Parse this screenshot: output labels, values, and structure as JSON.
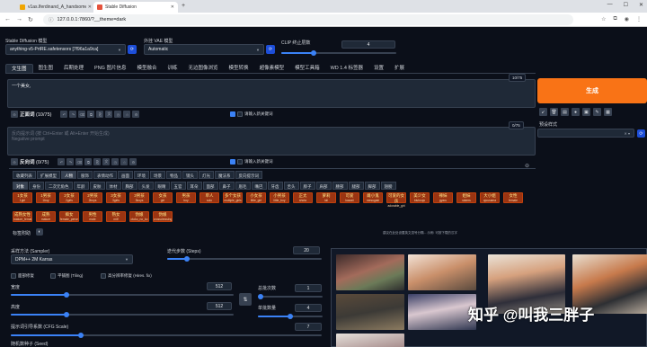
{
  "browser": {
    "tabs": [
      {
        "title": "v1as.lferdinand_A_handsome",
        "active": false
      },
      {
        "title": "Stable Diffusion",
        "active": true
      }
    ],
    "url": "127.0.0.1:7860/?__theme=dark"
  },
  "model": {
    "checkpoint_label": "Stable Diffusion 模型",
    "checkpoint_value": "anything-v5-PrtRE.safetensors [7f96a1a9ca]",
    "vae_label": "外挂 VAE 模型",
    "vae_value": "Automatic",
    "clip_label": "CLIP 终止层数",
    "clip_value": "4"
  },
  "tabs": [
    "文生图",
    "图生图",
    "后期处理",
    "PNG 图片信息",
    "模型融合",
    "训练",
    "无边图像浏览",
    "模型转换",
    "超像素模型",
    "模型工具箱",
    "WD 1.4 标签器",
    "设置",
    "扩展"
  ],
  "prompt": {
    "text": "一个美女,",
    "counter": "10/75",
    "section_label": "正面词",
    "section_count": "(10/75)",
    "checkbox_label": "请输入新关键词"
  },
  "negative": {
    "placeholder_line1": "反向提示词 (按 Ctrl+Enter 或 Alt+Enter 开始生成)",
    "placeholder_line2": "Negative prompt",
    "counter": "0/75",
    "section_label": "反向词",
    "section_count": "(0/75)",
    "checkbox_label": "请输入新关键词"
  },
  "generate": {
    "label": "生成",
    "style_label": "预设样式"
  },
  "category_tabs": [
    "收藏列表",
    "扩展模型",
    "人物",
    "服饰",
    "表情动作",
    "画面",
    "环境",
    "场景",
    "物品",
    "镜头",
    "灯光",
    "魔法系",
    "反向提示词"
  ],
  "sub_tabs": [
    "对象",
    "身份",
    "二次元角色",
    "年龄",
    "皮肤",
    "体材",
    "胸部",
    "头发",
    "眼睛",
    "五官",
    "耳朵",
    "面部",
    "鼻子",
    "眉毛",
    "嘴巴",
    "牙齿",
    "舌头",
    "脖子",
    "肩部",
    "腰部",
    "腿部",
    "脚部",
    "翅膀"
  ],
  "keywords_row1": [
    {
      "zh": "1女孩",
      "en": "1girl"
    },
    {
      "zh": "1男孩",
      "en": "1boy"
    },
    {
      "zh": "2女孩",
      "en": "2girls"
    },
    {
      "zh": "2男孩",
      "en": "2boys"
    },
    {
      "zh": "3女孩",
      "en": "3girls"
    },
    {
      "zh": "3男孩",
      "en": "3boys"
    },
    {
      "zh": "女孩",
      "en": "girl"
    },
    {
      "zh": "男孩",
      "en": "boy"
    },
    {
      "zh": "单人",
      "en": "solo"
    },
    {
      "zh": "多个女孩",
      "en": "multiple_girls"
    },
    {
      "zh": "小女孩",
      "en": "little_girl"
    },
    {
      "zh": "小男孩",
      "en": "little_boy"
    },
    {
      "zh": "正太",
      "en": "shota"
    },
    {
      "zh": "萝莉",
      "en": "loli"
    },
    {
      "zh": "可爱",
      "en": "kawaii"
    },
    {
      "zh": "雌小鬼",
      "en": "mesugaki"
    },
    {
      "zh": "可爱的女孩",
      "en": "adorable_girl"
    },
    {
      "zh": "美少女",
      "en": "bishoujo"
    },
    {
      "zh": "辣妹",
      "en": "gyaru"
    },
    {
      "zh": "姐妹",
      "en": "sisters"
    },
    {
      "zh": "大小姐",
      "en": "ojousama"
    },
    {
      "zh": "女性",
      "en": "female"
    }
  ],
  "keywords_row2": [
    {
      "zh": "成熟女性",
      "en": "mature_female"
    },
    {
      "zh": "成熟",
      "en": "mature"
    },
    {
      "zh": "痴女",
      "en": "female_pervert"
    },
    {
      "zh": "男性",
      "en": "male"
    },
    {
      "zh": "熟女",
      "en": "milf"
    },
    {
      "zh": "伪娘",
      "en": "otoko_no_ko"
    },
    {
      "zh": "伪娘",
      "en": "crossdressing"
    }
  ],
  "tag_helper": {
    "label": "标签附助",
    "note": "建议在此处设置英文逗号分隔... 示例: 可按下载的汉字"
  },
  "settings": {
    "sampler_label": "采样方法 (Sampler)",
    "sampler_value": "DPM++ 2M Karras",
    "steps_label": "迭代步数 (Steps)",
    "steps_value": "20",
    "steps_fraction": 0.13,
    "checkboxes": [
      "面部修复",
      "平铺图 (Tiling)",
      "高分辨率修复 (Hires. fix)"
    ],
    "width_label": "宽度",
    "width_value": "512",
    "height_label": "高度",
    "height_value": "512",
    "swap_label": "⇅",
    "batch_count_label": "总批次数",
    "batch_count_value": "1",
    "batch_size_label": "单批数量",
    "batch_size_value": "4",
    "cfg_label": "提示词引导系数 (CFG Scale)",
    "cfg_value": "7",
    "seed_label": "随机数种子 (Seed)"
  },
  "watermark": "知乎 @叫我三胖子",
  "colors": {
    "accent_orange": "#f97316",
    "accent_blue": "#3b82f6",
    "background": "#0b0f19",
    "panel": "#1f2937"
  }
}
